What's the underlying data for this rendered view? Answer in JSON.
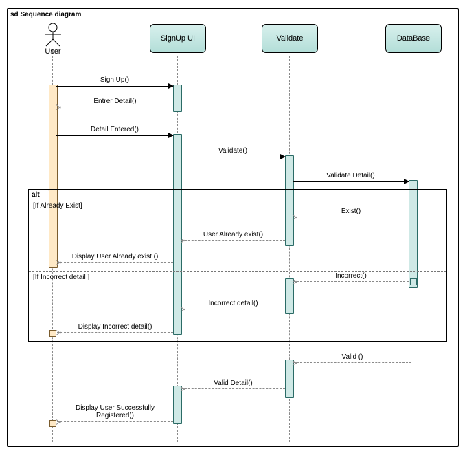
{
  "frame_title": "sd Sequence diagram",
  "lifelines": {
    "user": "User",
    "signup": "SignUp UI",
    "validate": "Validate",
    "database": "DataBase"
  },
  "fragment": {
    "label": "alt",
    "guard1": "[If Already Exist]",
    "guard2": "[If Incorrect detail ]"
  },
  "messages": {
    "m1": "Sign Up()",
    "m2": "Entrer Detail()",
    "m3": "Detail Entered()",
    "m4": "Validate()",
    "m5": "Validate Detail()",
    "m6": "Exist()",
    "m7": "User Already exist()",
    "m8": "Display User Already exist ()",
    "m9": "Incorrect()",
    "m10": "Incorrect detail()",
    "m11": "Display Incorrect detail()",
    "m12": "Valid ()",
    "m13": "Valid Detail()",
    "m14": "Display User Successfully Registered()"
  }
}
